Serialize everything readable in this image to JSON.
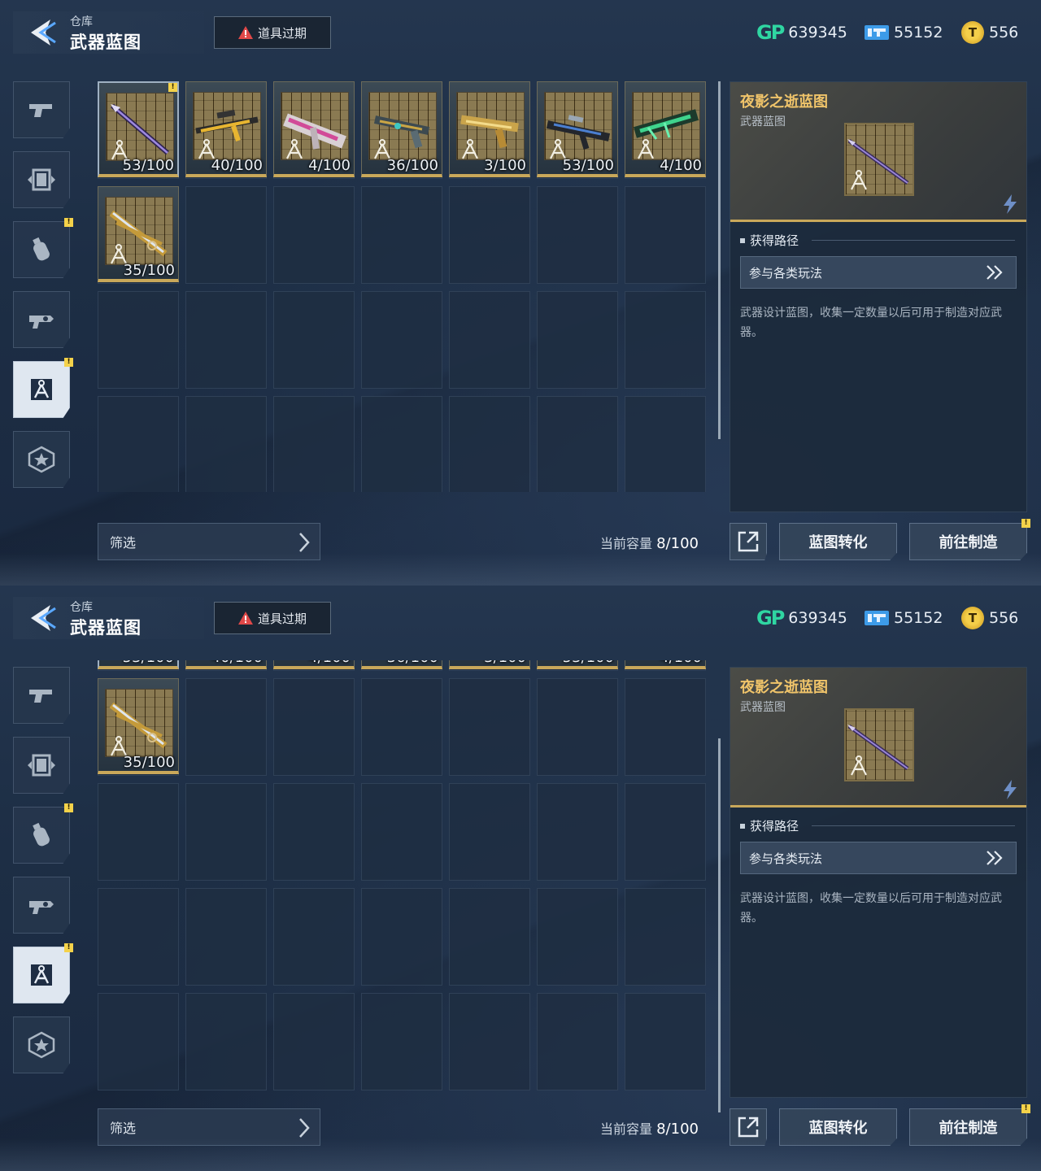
{
  "header": {
    "crumb": "仓库",
    "title": "武器蓝图",
    "expire_label": "道具过期"
  },
  "currency": {
    "gp_label": "GP",
    "gp": "639345",
    "ticket": "55152",
    "coin": "556"
  },
  "sidebar": {
    "items": [
      {
        "icon": "pistol-icon",
        "badge": false,
        "active": false
      },
      {
        "icon": "frame-icon",
        "badge": false,
        "active": false
      },
      {
        "icon": "grenade-icon",
        "badge": true,
        "active": false
      },
      {
        "icon": "gun-parts-icon",
        "badge": false,
        "active": false
      },
      {
        "icon": "blueprint-compass-icon",
        "badge": true,
        "active": true
      },
      {
        "icon": "star-emblem-icon",
        "badge": false,
        "active": false
      }
    ]
  },
  "inventory": {
    "items": [
      {
        "count": "53/100",
        "weapon": "spear-purple",
        "badge": true,
        "selected": true
      },
      {
        "count": "40/100",
        "weapon": "sniper-yellow",
        "badge": false,
        "selected": false
      },
      {
        "count": "4/100",
        "weapon": "cannon-pink",
        "badge": false,
        "selected": false
      },
      {
        "count": "36/100",
        "weapon": "pistol-teal",
        "badge": false,
        "selected": false
      },
      {
        "count": "3/100",
        "weapon": "pistol-gold",
        "badge": false,
        "selected": false
      },
      {
        "count": "53/100",
        "weapon": "rifle-dark",
        "badge": false,
        "selected": false
      },
      {
        "count": "4/100",
        "weapon": "rifle-green",
        "badge": false,
        "selected": false
      },
      {
        "count": "35/100",
        "weapon": "dagger-gold",
        "badge": false,
        "selected": false
      }
    ],
    "filter_label": "筛选",
    "capacity_label": "当前容量",
    "capacity_value": "8/100"
  },
  "detail": {
    "name": "夜影之逝蓝图",
    "type": "武器蓝图",
    "source_heading": "获得路径",
    "source_button": "参与各类玩法",
    "description": "武器设计蓝图，收集一定数量以后可用于制造对应武器。"
  },
  "actions": {
    "convert": "蓝图转化",
    "craft": "前往制造"
  },
  "colors": {
    "accent_gold": "#c9a85a",
    "name_gold": "#f0c46a",
    "gp_green": "#2fd6a2",
    "badge_yellow": "#f4d24a"
  }
}
